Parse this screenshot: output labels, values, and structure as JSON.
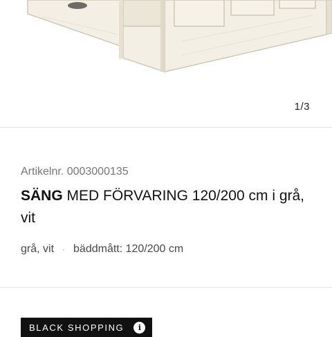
{
  "gallery": {
    "image_alt": "Säng med förvaring, grå/vit",
    "counter": "1/3",
    "colors": {
      "wood": "#f3efe4",
      "wood_shade": "#e6e0d0",
      "edge": "#cfc8b6",
      "handle": "#6e6a66"
    }
  },
  "product": {
    "article_label": "Artikelnr. 0003000135",
    "name": "SÄNG",
    "title_rest": " MED FÖRVARING 120/200 cm i grå, vit",
    "attributes": [
      "grå, vit",
      "bäddmått: 120/200 cm"
    ],
    "separator": "·"
  },
  "badge": {
    "label": "BLACK SHOPPING",
    "info_icon": "info-icon",
    "info_glyph": "i"
  }
}
